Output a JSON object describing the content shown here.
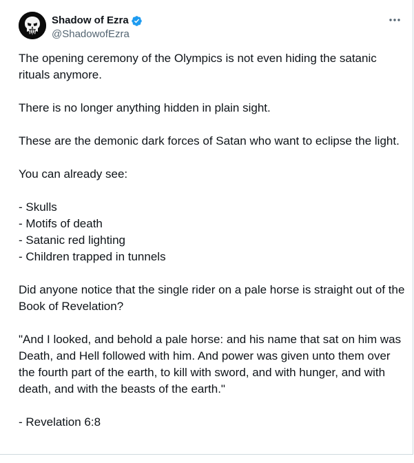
{
  "author": {
    "display_name": "Shadow of Ezra",
    "handle": "@ShadowofEzra",
    "avatar_icon": "punisher-skull-icon",
    "verified_icon": "verified-badge-icon",
    "verified_color": "#1d9bf0"
  },
  "menu": {
    "icon": "more-horizontal-icon"
  },
  "tweet": {
    "p1": "The opening ceremony of the Olympics is not even hiding the satanic rituals anymore.",
    "p2": "There is no longer anything hidden in plain sight.",
    "p3": "These are the demonic dark forces of Satan who want to eclipse the light.",
    "p4": "You can already see:",
    "list": [
      "- Skulls",
      "- Motifs of death",
      "- Satanic red lighting",
      "- Children trapped in tunnels"
    ],
    "p5": "Did anyone notice that the single rider on a pale horse is straight out of the Book of Revelation?",
    "p6": "\"And I looked, and behold a pale horse: and his name that sat on him was Death, and Hell followed with him. And power was given unto them over the fourth part of the earth, to kill with sword, and with hunger, and with death, and with the beasts of the earth.\"",
    "p7": "- Revelation 6:8"
  }
}
